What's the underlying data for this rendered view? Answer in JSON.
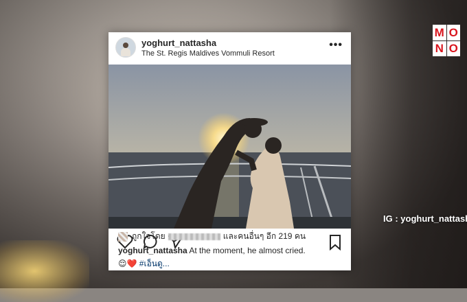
{
  "post": {
    "username": "yoghurt_nattasha",
    "location": "The St. Regis Maldives Vommuli Resort",
    "more_label": "•••",
    "likes": {
      "prefix": "ถูกใจโดย",
      "suffix": "และคนอื่นๆ อีก 219 คน"
    },
    "caption": {
      "username": "yoghurt_nattasha",
      "text": "At the moment, he almost cried.",
      "emojis": "😌❤️",
      "hashtag": "#เอ็นดู..."
    }
  },
  "overlay": {
    "ig_credit": "IG : yoghurt_nattasha"
  },
  "logo": {
    "letters": [
      "M",
      "O",
      "N",
      "O"
    ],
    "color": "#d9161e"
  },
  "icons": [
    "heart-icon",
    "comment-icon",
    "share-icon",
    "bookmark-icon",
    "more-icon"
  ]
}
